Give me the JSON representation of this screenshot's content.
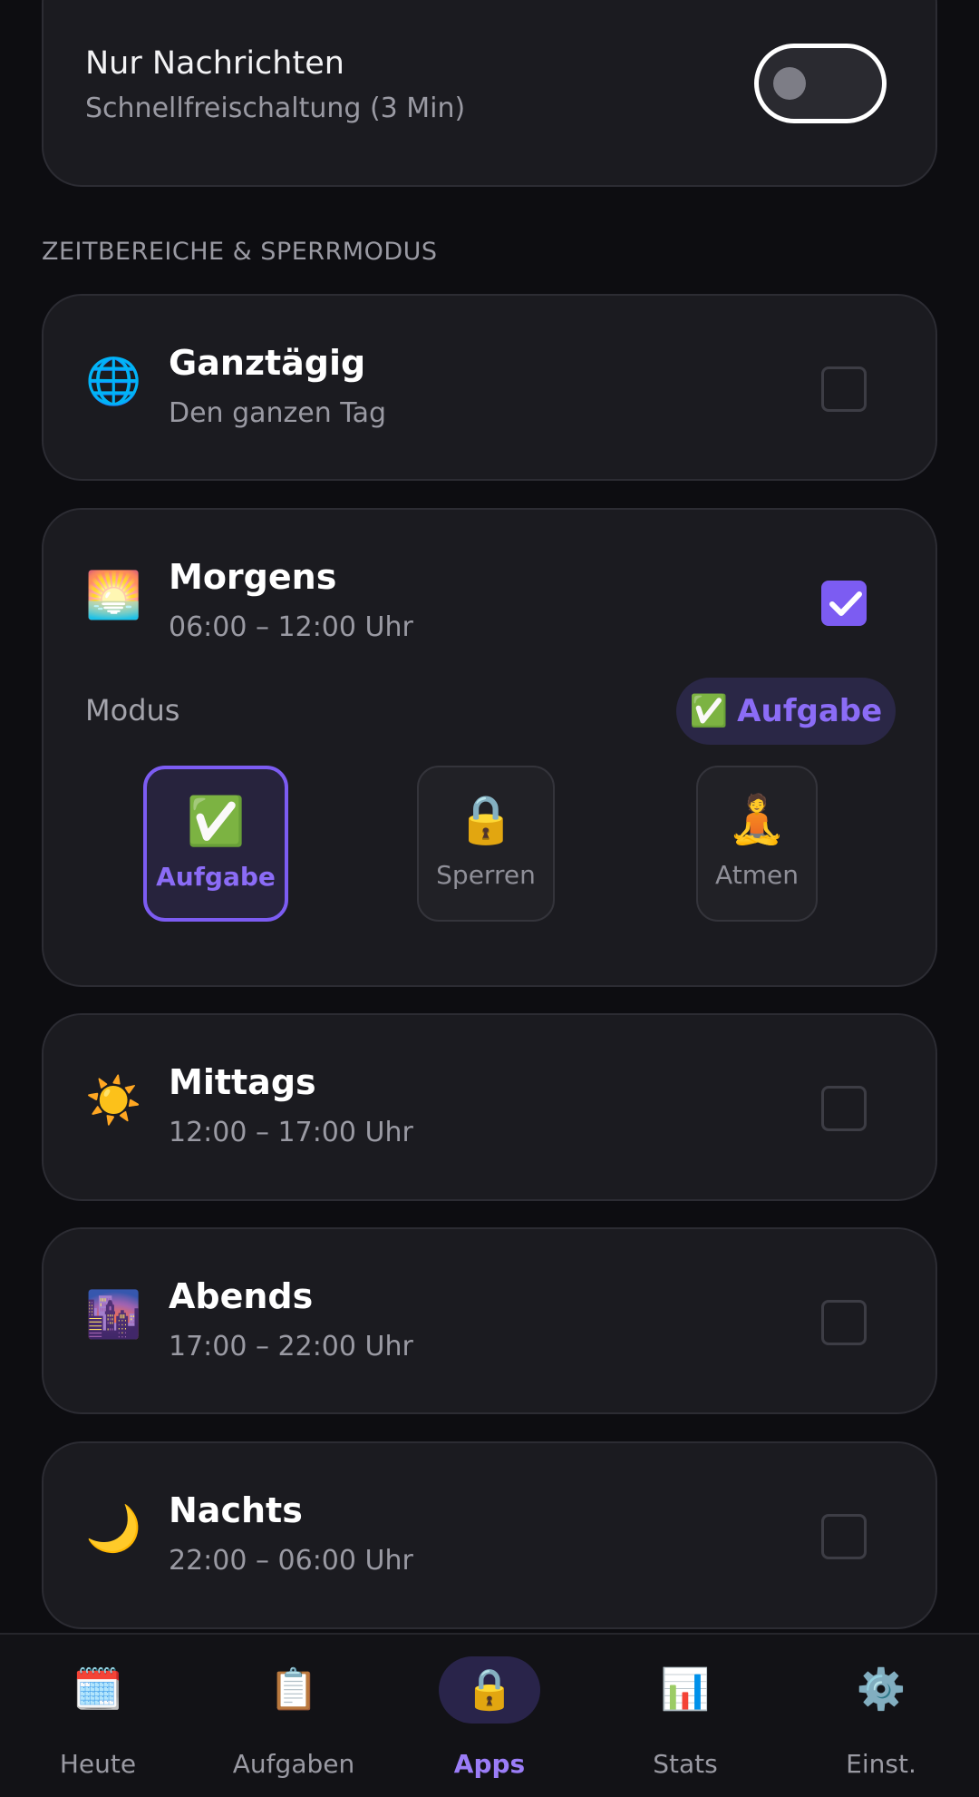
{
  "top_card": {
    "title": "Nur Nachrichten",
    "subtitle": "Schnellfreischaltung (3 Min)",
    "toggle_on": false
  },
  "section_label": "ZEITBEREICHE & SPERRMODUS",
  "slots": {
    "ganztaegig": {
      "icon": "🌐",
      "icon_name": "globe-icon",
      "title": "Ganztägig",
      "subtitle": "Den ganzen Tag",
      "checked": false
    },
    "morgens": {
      "icon": "🌅",
      "icon_name": "sunrise-icon",
      "title": "Morgens",
      "subtitle": "06:00 – 12:00 Uhr",
      "checked": true
    },
    "mittags": {
      "icon": "☀️",
      "icon_name": "sun-icon",
      "title": "Mittags",
      "subtitle": "12:00 – 17:00 Uhr",
      "checked": false
    },
    "abends": {
      "icon": "🌆",
      "icon_name": "city-dusk-icon",
      "title": "Abends",
      "subtitle": "17:00 – 22:00 Uhr",
      "checked": false
    },
    "nachts": {
      "icon": "🌙",
      "icon_name": "moon-icon",
      "title": "Nachts",
      "subtitle": "22:00 – 06:00 Uhr",
      "checked": false
    }
  },
  "mode": {
    "label": "Modus",
    "current_icon": "✅",
    "current_label": "Aufgabe",
    "options": [
      {
        "icon": "✅",
        "icon_name": "check-mark-icon",
        "label": "Aufgabe",
        "selected": true
      },
      {
        "icon": "🔒",
        "icon_name": "lock-icon",
        "label": "Sperren",
        "selected": false
      },
      {
        "icon": "🧘",
        "icon_name": "meditation-icon",
        "label": "Atmen",
        "selected": false
      }
    ]
  },
  "nav": [
    {
      "icon": "🗓️",
      "icon_name": "calendar-icon",
      "label": "Heute",
      "active": false
    },
    {
      "icon": "📋",
      "icon_name": "clipboard-icon",
      "label": "Aufgaben",
      "active": false
    },
    {
      "icon": "🔒",
      "icon_name": "lock-icon",
      "label": "Apps",
      "active": true
    },
    {
      "icon": "📊",
      "icon_name": "bar-chart-icon",
      "label": "Stats",
      "active": false
    },
    {
      "icon": "⚙️",
      "icon_name": "gear-icon",
      "label": "Einst.",
      "active": false
    }
  ],
  "colors": {
    "background": "#0d0d11",
    "card": "#1b1b20",
    "accent": "#7c5cf2",
    "text_secondary": "#9a9aa3"
  }
}
